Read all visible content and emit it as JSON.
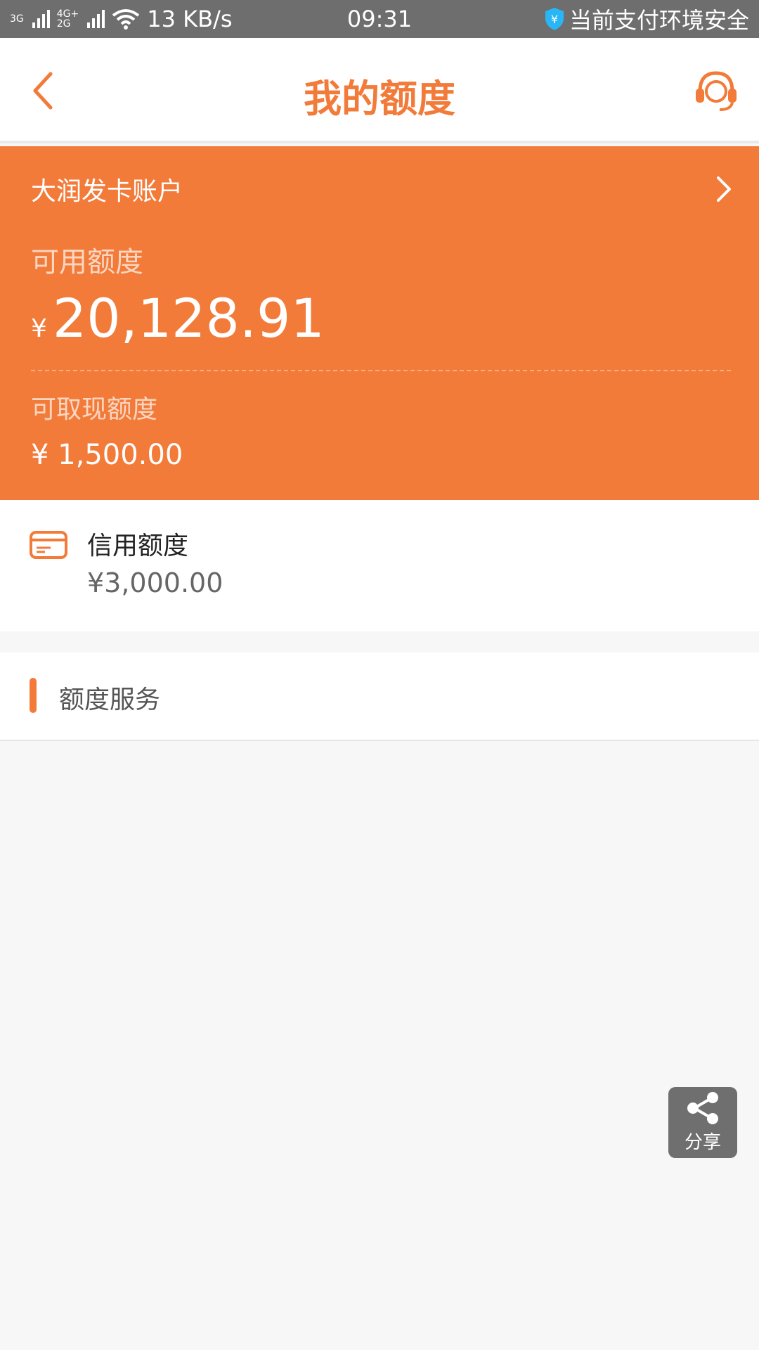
{
  "status_bar": {
    "net1": "3G",
    "net2_top": "4G+",
    "net2_bottom": "2G",
    "speed": "13 KB/s",
    "time": "09:31",
    "security_text": "当前支付环境安全"
  },
  "header": {
    "title": "我的额度"
  },
  "quota_card": {
    "account_name": "大润发卡账户",
    "available_label": "可用额度",
    "currency": "¥",
    "available_amount": "20,128.91",
    "cash_label": "可取现额度",
    "cash_amount": "¥ 1,500.00"
  },
  "credit": {
    "label": "信用额度",
    "amount": "¥3,000.00"
  },
  "service": {
    "title": "额度服务"
  },
  "share": {
    "label": "分享"
  },
  "colors": {
    "accent": "#f27b3a",
    "status_bar": "#6e6e6e",
    "background": "#f7f7f7"
  },
  "icons": {
    "back": "chevron-left-icon",
    "customer_service": "headset-icon",
    "account_arrow": "chevron-right-icon",
    "credit": "credit-card-icon",
    "share": "share-icon",
    "security": "shield-icon"
  }
}
